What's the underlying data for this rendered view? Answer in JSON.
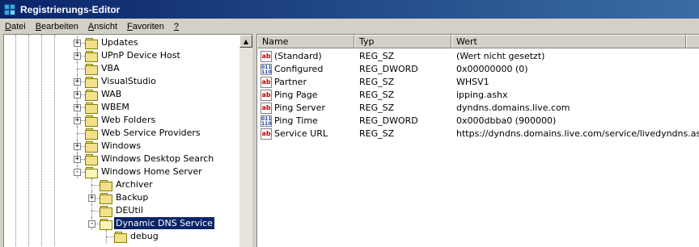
{
  "window": {
    "title": "Registrierungs-Editor"
  },
  "menu": [
    {
      "key": "D",
      "rest": "atei"
    },
    {
      "key": "B",
      "rest": "earbeiten"
    },
    {
      "key": "A",
      "rest": "nsicht"
    },
    {
      "key": "F",
      "rest": "avoriten"
    },
    {
      "key": "?",
      "rest": ""
    }
  ],
  "tree": [
    {
      "label": "Updates",
      "level": 0,
      "expander": "+",
      "open": false,
      "selected": false
    },
    {
      "label": "UPnP Device Host",
      "level": 0,
      "expander": "+",
      "open": false,
      "selected": false
    },
    {
      "label": "VBA",
      "level": 0,
      "expander": "",
      "open": false,
      "selected": false
    },
    {
      "label": "VisualStudio",
      "level": 0,
      "expander": "+",
      "open": false,
      "selected": false
    },
    {
      "label": "WAB",
      "level": 0,
      "expander": "+",
      "open": false,
      "selected": false
    },
    {
      "label": "WBEM",
      "level": 0,
      "expander": "+",
      "open": false,
      "selected": false
    },
    {
      "label": "Web Folders",
      "level": 0,
      "expander": "+",
      "open": false,
      "selected": false
    },
    {
      "label": "Web Service Providers",
      "level": 0,
      "expander": "",
      "open": false,
      "selected": false
    },
    {
      "label": "Windows",
      "level": 0,
      "expander": "+",
      "open": false,
      "selected": false
    },
    {
      "label": "Windows Desktop Search",
      "level": 0,
      "expander": "+",
      "open": false,
      "selected": false
    },
    {
      "label": "Windows Home Server",
      "level": 0,
      "expander": "-",
      "open": true,
      "selected": false
    },
    {
      "label": "Archiver",
      "level": 1,
      "expander": "",
      "open": false,
      "selected": false
    },
    {
      "label": "Backup",
      "level": 1,
      "expander": "+",
      "open": false,
      "selected": false
    },
    {
      "label": "DEUtil",
      "level": 1,
      "expander": "",
      "open": false,
      "selected": false
    },
    {
      "label": "Dynamic DNS Service",
      "level": 1,
      "expander": "-",
      "open": true,
      "selected": true
    },
    {
      "label": "debug",
      "level": 2,
      "expander": "",
      "open": false,
      "selected": false
    }
  ],
  "list": {
    "columns": [
      "Name",
      "Typ",
      "Wert"
    ],
    "rows": [
      {
        "name": "(Standard)",
        "type": "REG_SZ",
        "value": "(Wert nicht gesetzt)",
        "icon": "string-value-icon",
        "kind": "str"
      },
      {
        "name": "Configured",
        "type": "REG_DWORD",
        "value": "0x00000000 (0)",
        "icon": "binary-value-icon",
        "kind": "bin"
      },
      {
        "name": "Partner",
        "type": "REG_SZ",
        "value": "WHSV1",
        "icon": "string-value-icon",
        "kind": "str"
      },
      {
        "name": "Ping Page",
        "type": "REG_SZ",
        "value": "ipping.ashx",
        "icon": "string-value-icon",
        "kind": "str"
      },
      {
        "name": "Ping Server",
        "type": "REG_SZ",
        "value": "dyndns.domains.live.com",
        "icon": "string-value-icon",
        "kind": "str"
      },
      {
        "name": "Ping Time",
        "type": "REG_DWORD",
        "value": "0x000dbba0 (900000)",
        "icon": "binary-value-icon",
        "kind": "bin"
      },
      {
        "name": "Service URL",
        "type": "REG_SZ",
        "value": "https://dyndns.domains.live.com/service/livedyndns.asmx",
        "icon": "string-value-icon",
        "kind": "str"
      }
    ]
  },
  "icons": {
    "str_glyph": "ab",
    "bin_glyph": "011 110"
  }
}
